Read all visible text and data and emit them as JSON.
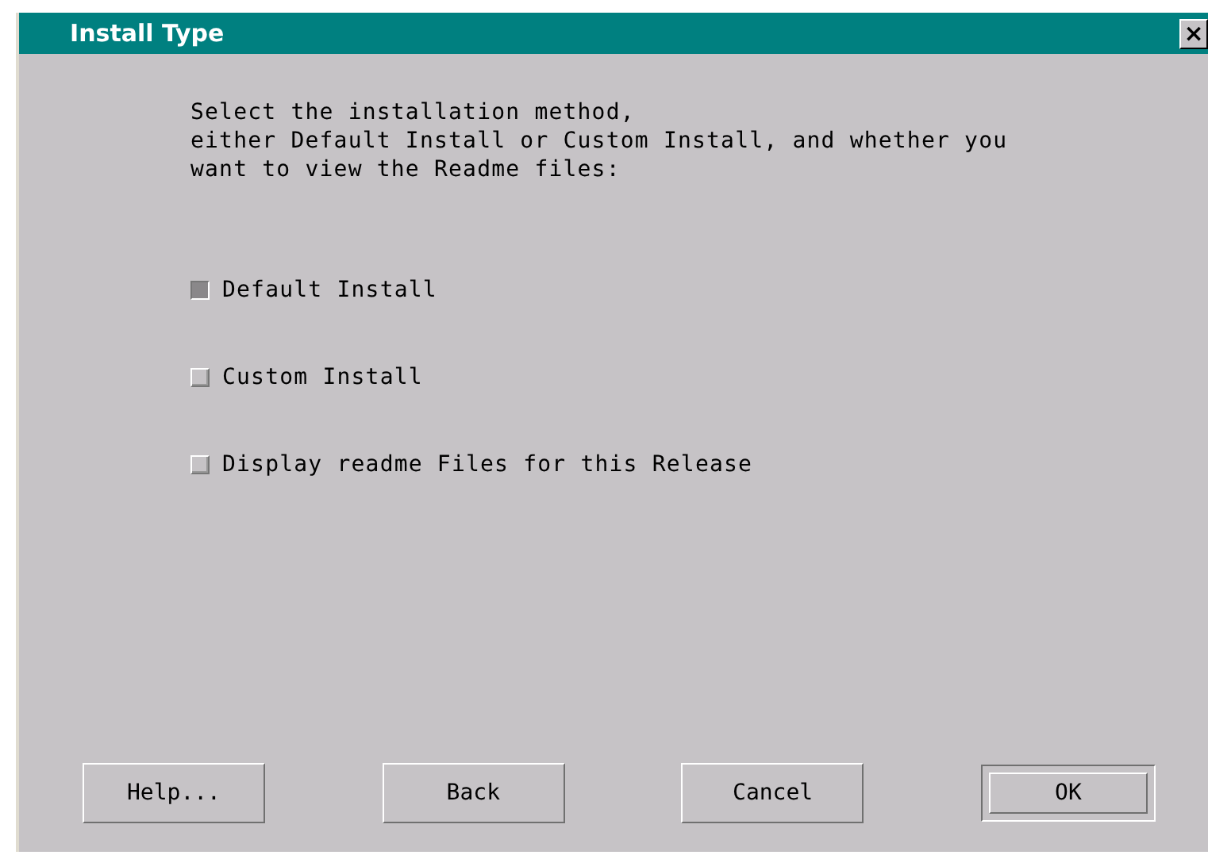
{
  "window": {
    "title": "Install Type",
    "close": "×"
  },
  "instructions": [
    "Select the installation method,",
    "either Default Install or Custom Install, and whether you",
    "want to view the Readme files:"
  ],
  "options": [
    {
      "label": "Default Install",
      "checked": true
    },
    {
      "label": "Custom Install",
      "checked": false
    },
    {
      "label": "Display readme Files for this Release",
      "checked": false
    }
  ],
  "buttons": [
    {
      "label": "Help...",
      "default": false
    },
    {
      "label": "Back",
      "default": false
    },
    {
      "label": "Cancel",
      "default": false
    },
    {
      "label": "OK",
      "default": true
    }
  ]
}
